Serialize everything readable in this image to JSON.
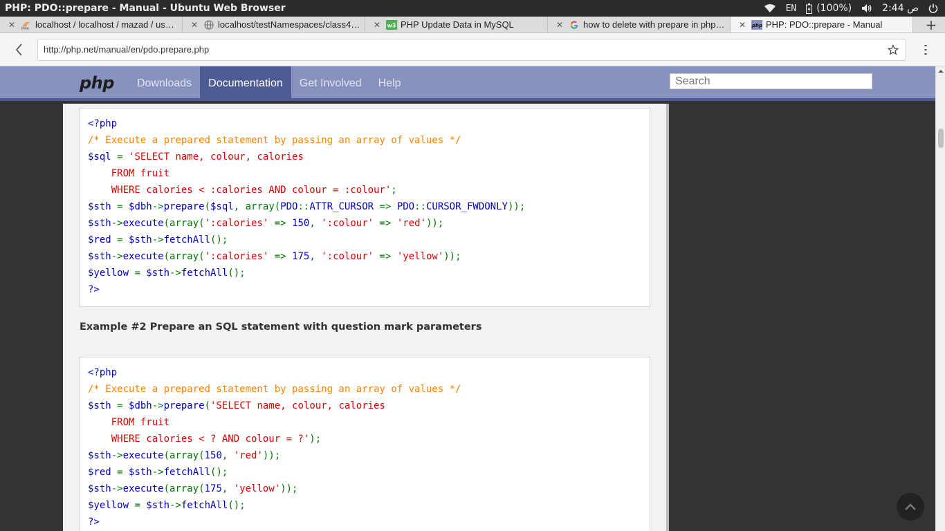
{
  "os": {
    "window_title": "PHP: PDO::prepare - Manual - Ubuntu Web Browser",
    "keyboard": "EN",
    "battery": "(100%)",
    "clock": "2:44 ص"
  },
  "tabs": [
    {
      "label": "localhost / localhost / mazad / user | p...",
      "icon": "phpmyadmin-icon"
    },
    {
      "label": "localhost/testNamespaces/class4.php",
      "icon": "none"
    },
    {
      "label": "PHP Update Data in MySQL",
      "icon": "w3-icon"
    },
    {
      "label": "how to delete with prepare in php - G...",
      "icon": "google-icon"
    },
    {
      "label": "PHP: PDO::prepare - Manual",
      "icon": "php-icon"
    }
  ],
  "address_bar": {
    "url": "http://php.net/manual/en/pdo.prepare.php"
  },
  "php_nav": {
    "logo": "php",
    "items": [
      "Downloads",
      "Documentation",
      "Get Involved",
      "Help"
    ],
    "active": "Documentation",
    "search_placeholder": "Search"
  },
  "content": {
    "example2_title": "Example #2 Prepare an SQL statement with question mark parameters",
    "code1": [
      [
        [
          "c-tag",
          "<?php"
        ]
      ],
      [
        [
          "c-comment",
          "/* Execute a prepared statement by passing an array of values */"
        ]
      ],
      [
        [
          "c-var",
          "$sql "
        ],
        [
          "c-kw",
          "= "
        ],
        [
          "c-str",
          "'SELECT name, colour, calories"
        ]
      ],
      [
        [
          "c-str",
          "    FROM fruit"
        ]
      ],
      [
        [
          "c-str",
          "    WHERE calories < :calories AND colour = :colour'"
        ],
        [
          "c-kw",
          ";"
        ]
      ],
      [
        [
          "c-var",
          "$sth "
        ],
        [
          "c-kw",
          "= "
        ],
        [
          "c-var",
          "$dbh"
        ],
        [
          "c-kw",
          "->"
        ],
        [
          "c-var",
          "prepare"
        ],
        [
          "c-kw",
          "("
        ],
        [
          "c-var",
          "$sql"
        ],
        [
          "c-kw",
          ", array("
        ],
        [
          "c-var",
          "PDO"
        ],
        [
          "c-kw",
          "::"
        ],
        [
          "c-var",
          "ATTR_CURSOR "
        ],
        [
          "c-kw",
          "=> "
        ],
        [
          "c-var",
          "PDO"
        ],
        [
          "c-kw",
          "::"
        ],
        [
          "c-var",
          "CURSOR_FWDONLY"
        ],
        [
          "c-kw",
          "));"
        ]
      ],
      [
        [
          "c-var",
          "$sth"
        ],
        [
          "c-kw",
          "->"
        ],
        [
          "c-var",
          "execute"
        ],
        [
          "c-kw",
          "(array("
        ],
        [
          "c-str",
          "':calories' "
        ],
        [
          "c-kw",
          "=> "
        ],
        [
          "c-var",
          "150"
        ],
        [
          "c-kw",
          ", "
        ],
        [
          "c-str",
          "':colour' "
        ],
        [
          "c-kw",
          "=> "
        ],
        [
          "c-str",
          "'red'"
        ],
        [
          "c-kw",
          "));"
        ]
      ],
      [
        [
          "c-var",
          "$red "
        ],
        [
          "c-kw",
          "= "
        ],
        [
          "c-var",
          "$sth"
        ],
        [
          "c-kw",
          "->"
        ],
        [
          "c-var",
          "fetchAll"
        ],
        [
          "c-kw",
          "();"
        ]
      ],
      [
        [
          "c-var",
          "$sth"
        ],
        [
          "c-kw",
          "->"
        ],
        [
          "c-var",
          "execute"
        ],
        [
          "c-kw",
          "(array("
        ],
        [
          "c-str",
          "':calories' "
        ],
        [
          "c-kw",
          "=> "
        ],
        [
          "c-var",
          "175"
        ],
        [
          "c-kw",
          ", "
        ],
        [
          "c-str",
          "':colour' "
        ],
        [
          "c-kw",
          "=> "
        ],
        [
          "c-str",
          "'yellow'"
        ],
        [
          "c-kw",
          "));"
        ]
      ],
      [
        [
          "c-var",
          "$yellow "
        ],
        [
          "c-kw",
          "= "
        ],
        [
          "c-var",
          "$sth"
        ],
        [
          "c-kw",
          "->"
        ],
        [
          "c-var",
          "fetchAll"
        ],
        [
          "c-kw",
          "();"
        ]
      ],
      [
        [
          "c-tag",
          "?>"
        ]
      ]
    ],
    "code2": [
      [
        [
          "c-tag",
          "<?php"
        ]
      ],
      [
        [
          "c-comment",
          "/* Execute a prepared statement by passing an array of values */"
        ]
      ],
      [
        [
          "c-var",
          "$sth "
        ],
        [
          "c-kw",
          "= "
        ],
        [
          "c-var",
          "$dbh"
        ],
        [
          "c-kw",
          "->"
        ],
        [
          "c-var",
          "prepare"
        ],
        [
          "c-kw",
          "("
        ],
        [
          "c-str",
          "'SELECT name, colour, calories"
        ]
      ],
      [
        [
          "c-str",
          "    FROM fruit"
        ]
      ],
      [
        [
          "c-str",
          "    WHERE calories < ? AND colour = ?'"
        ],
        [
          "c-kw",
          ");"
        ]
      ],
      [
        [
          "c-var",
          "$sth"
        ],
        [
          "c-kw",
          "->"
        ],
        [
          "c-var",
          "execute"
        ],
        [
          "c-kw",
          "(array("
        ],
        [
          "c-var",
          "150"
        ],
        [
          "c-kw",
          ", "
        ],
        [
          "c-str",
          "'red'"
        ],
        [
          "c-kw",
          "));"
        ]
      ],
      [
        [
          "c-var",
          "$red "
        ],
        [
          "c-kw",
          "= "
        ],
        [
          "c-var",
          "$sth"
        ],
        [
          "c-kw",
          "->"
        ],
        [
          "c-var",
          "fetchAll"
        ],
        [
          "c-kw",
          "();"
        ]
      ],
      [
        [
          "c-var",
          "$sth"
        ],
        [
          "c-kw",
          "->"
        ],
        [
          "c-var",
          "execute"
        ],
        [
          "c-kw",
          "(array("
        ],
        [
          "c-var",
          "175"
        ],
        [
          "c-kw",
          ", "
        ],
        [
          "c-str",
          "'yellow'"
        ],
        [
          "c-kw",
          "));"
        ]
      ],
      [
        [
          "c-var",
          "$yellow "
        ],
        [
          "c-kw",
          "= "
        ],
        [
          "c-var",
          "$sth"
        ],
        [
          "c-kw",
          "->"
        ],
        [
          "c-var",
          "fetchAll"
        ],
        [
          "c-kw",
          "();"
        ]
      ],
      [
        [
          "c-tag",
          "?>"
        ]
      ]
    ]
  },
  "colors": {
    "php_nav_bg": "#8892bf",
    "php_nav_active": "#4f5b93",
    "code_var": "#0000bb",
    "code_string": "#dd0000",
    "code_keyword": "#007700",
    "code_comment": "#ff8000"
  }
}
